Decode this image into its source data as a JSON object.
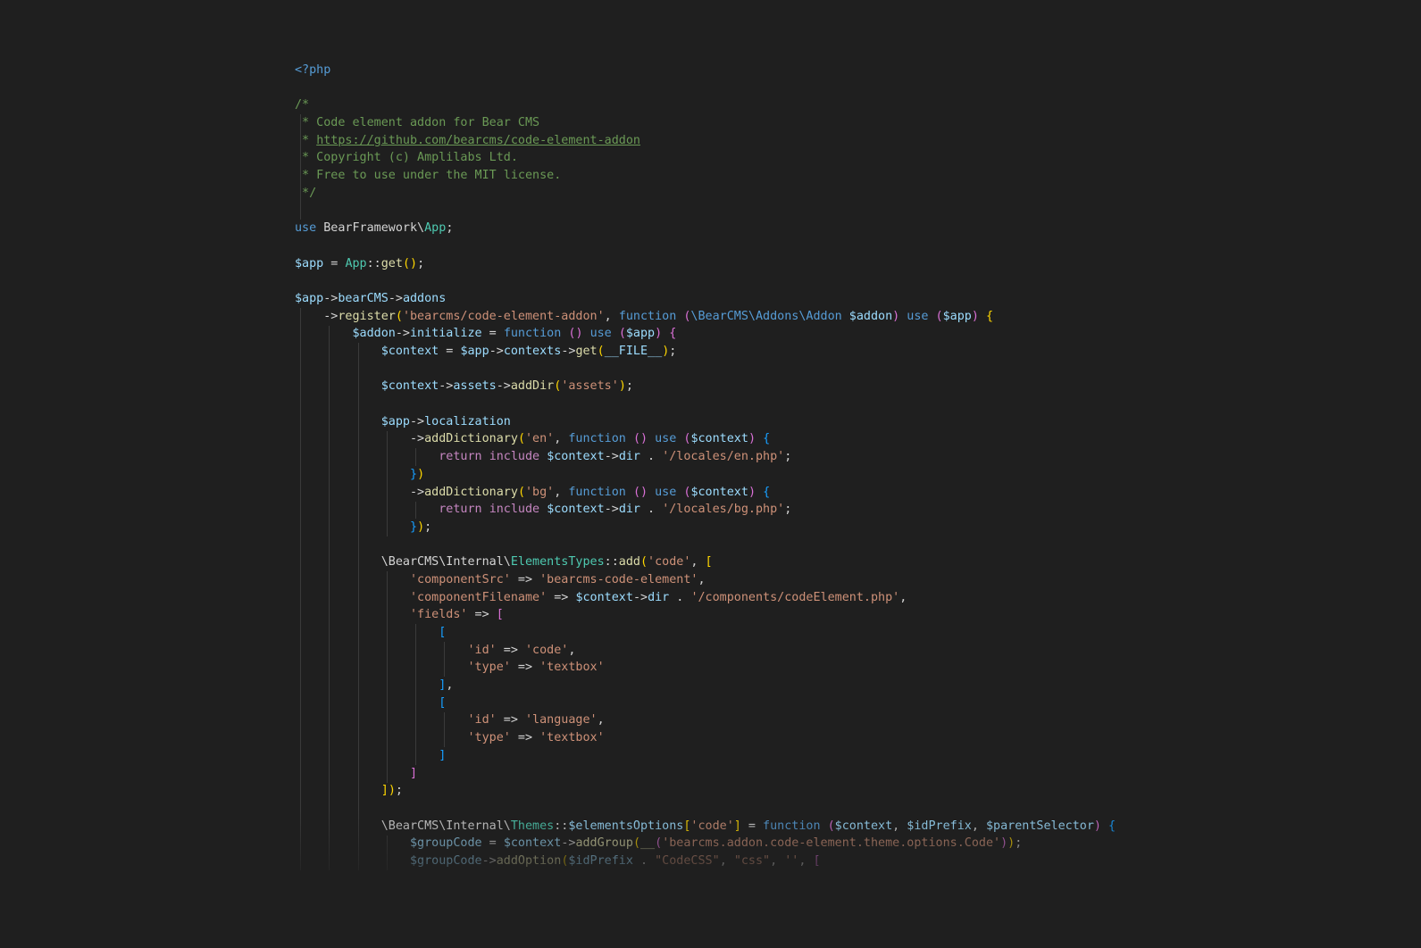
{
  "editor": {
    "language": "php",
    "file_description": "Bear CMS code element addon bootstrap file",
    "palette": {
      "background": "#1f1f1f",
      "default": "#d4d4d4",
      "keyword": "#569cd6",
      "control": "#c586c0",
      "comment": "#6a9955",
      "string": "#ce9178",
      "class": "#4ec9b0",
      "function": "#dcdcaa",
      "variable": "#9cdcfe",
      "bracket1": "#ffd700",
      "bracket2": "#da70d6",
      "bracket3": "#179fff",
      "indent_guide": "#3a3a3a"
    },
    "comment_url": "https://github.com/bearcms/code-element-addon",
    "lines": [
      {
        "t": [
          [
            "<?php",
            "kw"
          ]
        ]
      },
      {
        "t": []
      },
      {
        "t": [
          [
            "/*",
            "com"
          ]
        ]
      },
      {
        "t": [
          [
            " * Code element addon for Bear CMS",
            "com"
          ]
        ]
      },
      {
        "t": [
          [
            " * ",
            "com"
          ],
          [
            "https://github.com/bearcms/code-element-addon",
            "lnk"
          ]
        ]
      },
      {
        "t": [
          [
            " * Copyright (c) Amplilabs Ltd.",
            "com"
          ]
        ]
      },
      {
        "t": [
          [
            " * Free to use under the MIT license.",
            "com"
          ]
        ]
      },
      {
        "t": [
          [
            " */",
            "com"
          ]
        ]
      },
      {
        "t": []
      },
      {
        "t": [
          [
            "use ",
            "kw"
          ],
          [
            "BearFramework\\",
            "pun"
          ],
          [
            "App",
            "cls"
          ],
          [
            ";",
            "pun"
          ]
        ]
      },
      {
        "t": []
      },
      {
        "t": [
          [
            "$app",
            "var"
          ],
          [
            " = ",
            "pun"
          ],
          [
            "App",
            "cls"
          ],
          [
            "::",
            "pun"
          ],
          [
            "get",
            "fn"
          ],
          [
            "(",
            "b1"
          ],
          [
            ")",
            "b1"
          ],
          [
            ";",
            "pun"
          ]
        ]
      },
      {
        "t": []
      },
      {
        "t": [
          [
            "$app",
            "var"
          ],
          [
            "->",
            "pun"
          ],
          [
            "bearCMS",
            "var"
          ],
          [
            "->",
            "pun"
          ],
          [
            "addons",
            "var"
          ]
        ]
      },
      {
        "t": [
          [
            "    ->",
            "pun"
          ],
          [
            "register",
            "fn"
          ],
          [
            "(",
            "b1"
          ],
          [
            "'bearcms/code-element-addon'",
            "str"
          ],
          [
            ", ",
            "pun"
          ],
          [
            "function ",
            "kw"
          ],
          [
            "(",
            "b2"
          ],
          [
            "\\BearCMS\\Addons\\Addon",
            "kw"
          ],
          [
            " ",
            "pun"
          ],
          [
            "$addon",
            "var"
          ],
          [
            ")",
            "b2"
          ],
          [
            " ",
            "pun"
          ],
          [
            "use ",
            "kw"
          ],
          [
            "(",
            "b2"
          ],
          [
            "$app",
            "var"
          ],
          [
            ")",
            "b2"
          ],
          [
            " ",
            "pun"
          ],
          [
            "{",
            "b1"
          ]
        ]
      },
      {
        "t": [
          [
            "        ",
            "pun"
          ],
          [
            "$addon",
            "var"
          ],
          [
            "->",
            "pun"
          ],
          [
            "initialize",
            "var"
          ],
          [
            " = ",
            "pun"
          ],
          [
            "function ",
            "kw"
          ],
          [
            "(",
            "b2"
          ],
          [
            ")",
            "b2"
          ],
          [
            " ",
            "pun"
          ],
          [
            "use ",
            "kw"
          ],
          [
            "(",
            "b2"
          ],
          [
            "$app",
            "var"
          ],
          [
            ")",
            "b2"
          ],
          [
            " ",
            "pun"
          ],
          [
            "{",
            "b2"
          ]
        ]
      },
      {
        "t": [
          [
            "            ",
            "pun"
          ],
          [
            "$context",
            "var"
          ],
          [
            " = ",
            "pun"
          ],
          [
            "$app",
            "var"
          ],
          [
            "->",
            "pun"
          ],
          [
            "contexts",
            "var"
          ],
          [
            "->",
            "pun"
          ],
          [
            "get",
            "fn"
          ],
          [
            "(",
            "b1"
          ],
          [
            "__FILE__",
            "var"
          ],
          [
            ")",
            "b1"
          ],
          [
            ";",
            "pun"
          ]
        ]
      },
      {
        "t": []
      },
      {
        "t": [
          [
            "            ",
            "pun"
          ],
          [
            "$context",
            "var"
          ],
          [
            "->",
            "pun"
          ],
          [
            "assets",
            "var"
          ],
          [
            "->",
            "pun"
          ],
          [
            "addDir",
            "fn"
          ],
          [
            "(",
            "b1"
          ],
          [
            "'assets'",
            "str"
          ],
          [
            ")",
            "b1"
          ],
          [
            ";",
            "pun"
          ]
        ]
      },
      {
        "t": []
      },
      {
        "t": [
          [
            "            ",
            "pun"
          ],
          [
            "$app",
            "var"
          ],
          [
            "->",
            "pun"
          ],
          [
            "localization",
            "var"
          ]
        ]
      },
      {
        "t": [
          [
            "                ->",
            "pun"
          ],
          [
            "addDictionary",
            "fn"
          ],
          [
            "(",
            "b1"
          ],
          [
            "'en'",
            "str"
          ],
          [
            ", ",
            "pun"
          ],
          [
            "function ",
            "kw"
          ],
          [
            "(",
            "b2"
          ],
          [
            ")",
            "b2"
          ],
          [
            " ",
            "pun"
          ],
          [
            "use ",
            "kw"
          ],
          [
            "(",
            "b2"
          ],
          [
            "$context",
            "var"
          ],
          [
            ")",
            "b2"
          ],
          [
            " ",
            "pun"
          ],
          [
            "{",
            "b3"
          ]
        ]
      },
      {
        "t": [
          [
            "                    ",
            "pun"
          ],
          [
            "return",
            "ctl"
          ],
          [
            " ",
            "pun"
          ],
          [
            "include",
            "ctl"
          ],
          [
            " ",
            "pun"
          ],
          [
            "$context",
            "var"
          ],
          [
            "->",
            "pun"
          ],
          [
            "dir",
            "var"
          ],
          [
            " . ",
            "pun"
          ],
          [
            "'/locales/en.php'",
            "str"
          ],
          [
            ";",
            "pun"
          ]
        ]
      },
      {
        "t": [
          [
            "                ",
            "pun"
          ],
          [
            "}",
            "b3"
          ],
          [
            ")",
            "b1"
          ]
        ]
      },
      {
        "t": [
          [
            "                ->",
            "pun"
          ],
          [
            "addDictionary",
            "fn"
          ],
          [
            "(",
            "b1"
          ],
          [
            "'bg'",
            "str"
          ],
          [
            ", ",
            "pun"
          ],
          [
            "function ",
            "kw"
          ],
          [
            "(",
            "b2"
          ],
          [
            ")",
            "b2"
          ],
          [
            " ",
            "pun"
          ],
          [
            "use ",
            "kw"
          ],
          [
            "(",
            "b2"
          ],
          [
            "$context",
            "var"
          ],
          [
            ")",
            "b2"
          ],
          [
            " ",
            "pun"
          ],
          [
            "{",
            "b3"
          ]
        ]
      },
      {
        "t": [
          [
            "                    ",
            "pun"
          ],
          [
            "return",
            "ctl"
          ],
          [
            " ",
            "pun"
          ],
          [
            "include",
            "ctl"
          ],
          [
            " ",
            "pun"
          ],
          [
            "$context",
            "var"
          ],
          [
            "->",
            "pun"
          ],
          [
            "dir",
            "var"
          ],
          [
            " . ",
            "pun"
          ],
          [
            "'/locales/bg.php'",
            "str"
          ],
          [
            ";",
            "pun"
          ]
        ]
      },
      {
        "t": [
          [
            "                ",
            "pun"
          ],
          [
            "}",
            "b3"
          ],
          [
            ")",
            "b1"
          ],
          [
            ";",
            "pun"
          ]
        ]
      },
      {
        "t": []
      },
      {
        "t": [
          [
            "            \\BearCMS\\Internal\\",
            "pun"
          ],
          [
            "ElementsTypes",
            "cls"
          ],
          [
            "::",
            "pun"
          ],
          [
            "add",
            "fn"
          ],
          [
            "(",
            "b1"
          ],
          [
            "'code'",
            "str"
          ],
          [
            ", ",
            "pun"
          ],
          [
            "[",
            "b1"
          ]
        ]
      },
      {
        "t": [
          [
            "                ",
            "pun"
          ],
          [
            "'componentSrc'",
            "str"
          ],
          [
            " => ",
            "pun"
          ],
          [
            "'bearcms-code-element'",
            "str"
          ],
          [
            ",",
            "pun"
          ]
        ]
      },
      {
        "t": [
          [
            "                ",
            "pun"
          ],
          [
            "'componentFilename'",
            "str"
          ],
          [
            " => ",
            "pun"
          ],
          [
            "$context",
            "var"
          ],
          [
            "->",
            "pun"
          ],
          [
            "dir",
            "var"
          ],
          [
            " . ",
            "pun"
          ],
          [
            "'/components/codeElement.php'",
            "str"
          ],
          [
            ",",
            "pun"
          ]
        ]
      },
      {
        "t": [
          [
            "                ",
            "pun"
          ],
          [
            "'fields'",
            "str"
          ],
          [
            " => ",
            "pun"
          ],
          [
            "[",
            "b2"
          ]
        ]
      },
      {
        "t": [
          [
            "                    ",
            "pun"
          ],
          [
            "[",
            "b3"
          ]
        ]
      },
      {
        "t": [
          [
            "                        ",
            "pun"
          ],
          [
            "'id'",
            "str"
          ],
          [
            " => ",
            "pun"
          ],
          [
            "'code'",
            "str"
          ],
          [
            ",",
            "pun"
          ]
        ]
      },
      {
        "t": [
          [
            "                        ",
            "pun"
          ],
          [
            "'type'",
            "str"
          ],
          [
            " => ",
            "pun"
          ],
          [
            "'textbox'",
            "str"
          ]
        ]
      },
      {
        "t": [
          [
            "                    ",
            "pun"
          ],
          [
            "]",
            "b3"
          ],
          [
            ",",
            "pun"
          ]
        ]
      },
      {
        "t": [
          [
            "                    ",
            "pun"
          ],
          [
            "[",
            "b3"
          ]
        ]
      },
      {
        "t": [
          [
            "                        ",
            "pun"
          ],
          [
            "'id'",
            "str"
          ],
          [
            " => ",
            "pun"
          ],
          [
            "'language'",
            "str"
          ],
          [
            ",",
            "pun"
          ]
        ]
      },
      {
        "t": [
          [
            "                        ",
            "pun"
          ],
          [
            "'type'",
            "str"
          ],
          [
            " => ",
            "pun"
          ],
          [
            "'textbox'",
            "str"
          ]
        ]
      },
      {
        "t": [
          [
            "                    ",
            "pun"
          ],
          [
            "]",
            "b3"
          ]
        ]
      },
      {
        "t": [
          [
            "                ",
            "pun"
          ],
          [
            "]",
            "b2"
          ]
        ]
      },
      {
        "t": [
          [
            "            ",
            "pun"
          ],
          [
            "]",
            "b1"
          ],
          [
            ")",
            "b1"
          ],
          [
            ";",
            "pun"
          ]
        ]
      },
      {
        "t": []
      },
      {
        "t": [
          [
            "            \\BearCMS\\Internal\\",
            "pun"
          ],
          [
            "Themes",
            "cls"
          ],
          [
            "::",
            "pun"
          ],
          [
            "$elementsOptions",
            "var"
          ],
          [
            "[",
            "b1"
          ],
          [
            "'code'",
            "str"
          ],
          [
            "]",
            "b1"
          ],
          [
            " = ",
            "pun"
          ],
          [
            "function ",
            "kw"
          ],
          [
            "(",
            "b2"
          ],
          [
            "$context",
            "var"
          ],
          [
            ", ",
            "pun"
          ],
          [
            "$idPrefix",
            "var"
          ],
          [
            ", ",
            "pun"
          ],
          [
            "$parentSelector",
            "var"
          ],
          [
            ")",
            "b2"
          ],
          [
            " ",
            "pun"
          ],
          [
            "{",
            "b3"
          ]
        ]
      },
      {
        "t": [
          [
            "                ",
            "pun"
          ],
          [
            "$groupCode",
            "var"
          ],
          [
            " = ",
            "pun"
          ],
          [
            "$context",
            "var"
          ],
          [
            "->",
            "pun"
          ],
          [
            "addGroup",
            "fn"
          ],
          [
            "(",
            "b1"
          ],
          [
            "__",
            "fn"
          ],
          [
            "(",
            "b2"
          ],
          [
            "'bearcms.addon.code-element.theme.options.Code'",
            "str"
          ],
          [
            ")",
            "b2"
          ],
          [
            ")",
            "b1"
          ],
          [
            ";",
            "pun"
          ]
        ]
      },
      {
        "t": [
          [
            "                ",
            "pun"
          ],
          [
            "$groupCode",
            "var"
          ],
          [
            "->",
            "pun"
          ],
          [
            "addOption",
            "fn"
          ],
          [
            "(",
            "b1"
          ],
          [
            "$idPrefix",
            "var"
          ],
          [
            " . ",
            "pun"
          ],
          [
            "\"CodeCSS\"",
            "str"
          ],
          [
            ", ",
            "pun"
          ],
          [
            "\"css\"",
            "str"
          ],
          [
            ", ",
            "pun"
          ],
          [
            "''",
            "str"
          ],
          [
            ", ",
            "pun"
          ],
          [
            "[",
            "b2"
          ]
        ]
      }
    ],
    "indent_guides": [
      {
        "col": 0,
        "from": 4,
        "to": 9
      },
      {
        "col": 0,
        "from": 15,
        "to": 46
      },
      {
        "col": 4,
        "from": 16,
        "to": 46
      },
      {
        "col": 8,
        "from": 17,
        "to": 46
      },
      {
        "col": 12,
        "from": 22,
        "to": 27
      },
      {
        "col": 12,
        "from": 30,
        "to": 41
      },
      {
        "col": 12,
        "from": 45,
        "to": 46
      },
      {
        "col": 16,
        "from": 23,
        "to": 23
      },
      {
        "col": 16,
        "from": 26,
        "to": 26
      },
      {
        "col": 16,
        "from": 33,
        "to": 40
      },
      {
        "col": 20,
        "from": 34,
        "to": 35
      },
      {
        "col": 20,
        "from": 38,
        "to": 39
      }
    ]
  }
}
